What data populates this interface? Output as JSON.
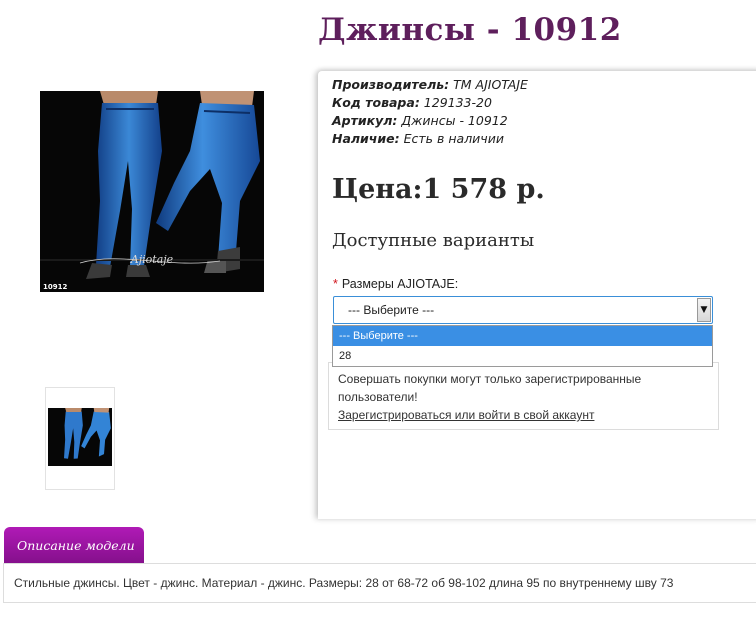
{
  "product": {
    "title": "Джинсы - 10912",
    "image_code": "10912",
    "image_signature": "Ajiotaje"
  },
  "info": {
    "manufacturer_label": "Производитель:",
    "manufacturer_value": "ТМ AJIOTAJE",
    "code_label": "Код товара:",
    "code_value": "129133-20",
    "article_label": "Артикул:",
    "article_value": "Джинсы - 10912",
    "availability_label": "Наличие:",
    "availability_value": "Есть в наличии"
  },
  "price": {
    "text": "Цена:1 578 р."
  },
  "variants": {
    "title": "Доступные варианты",
    "required_mark": "*",
    "size_label": "Размеры AJIOTAJE:",
    "selected_value": "--- Выберите ---",
    "options": [
      "--- Выберите ---",
      "28"
    ]
  },
  "notice": {
    "text": "Совершать покупки могут только зарегистрированные пользователи!",
    "link": "Зарегистрироваться или войти в свой аккаунт"
  },
  "tabs": {
    "description_tab": "Описание модели"
  },
  "description": {
    "text": "Стильные джинсы. Цвет - джинс. Материал - джинс. Размеры: 28 от 68-72 об 98-102 длина 95 по внутреннему шву 73"
  },
  "colors": {
    "title": "#5e1f5c",
    "tab": "#9c16a3",
    "select_highlight": "#3a8fe4",
    "denim": "#1f63b8"
  }
}
